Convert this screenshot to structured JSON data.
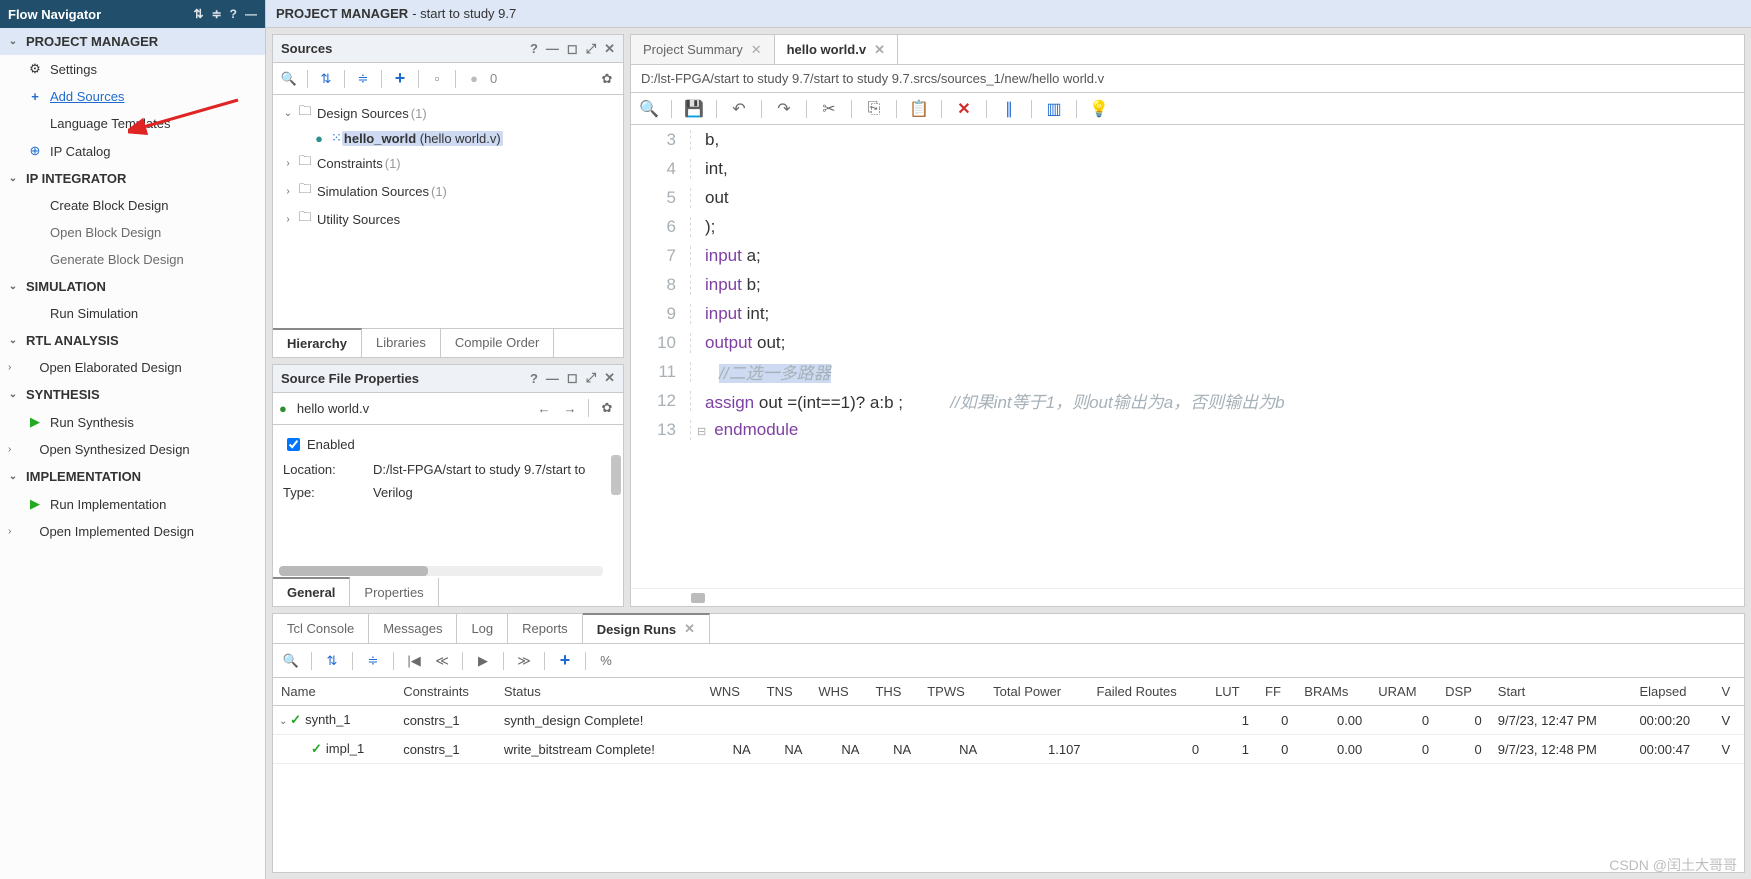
{
  "flowNavigator": {
    "title": "Flow Navigator",
    "sections": [
      {
        "label": "PROJECT MANAGER",
        "items": [
          {
            "label": "Settings",
            "icon": "gear"
          },
          {
            "label": "Add Sources",
            "link": true,
            "icon": "plus"
          },
          {
            "label": "Language Templates"
          },
          {
            "label": "IP Catalog",
            "icon": "ipcat"
          }
        ]
      },
      {
        "label": "IP INTEGRATOR",
        "items": [
          {
            "label": "Create Block Design"
          },
          {
            "label": "Open Block Design",
            "muted": true
          },
          {
            "label": "Generate Block Design",
            "muted": true
          }
        ]
      },
      {
        "label": "SIMULATION",
        "items": [
          {
            "label": "Run Simulation"
          }
        ]
      },
      {
        "label": "RTL ANALYSIS",
        "items": [
          {
            "label": "Open Elaborated Design",
            "chev": true
          }
        ]
      },
      {
        "label": "SYNTHESIS",
        "items": [
          {
            "label": "Run Synthesis",
            "icon": "play"
          },
          {
            "label": "Open Synthesized Design",
            "chev": true
          }
        ]
      },
      {
        "label": "IMPLEMENTATION",
        "items": [
          {
            "label": "Run Implementation",
            "icon": "play"
          },
          {
            "label": "Open Implemented Design",
            "chev": true
          }
        ]
      }
    ]
  },
  "projectManager": {
    "title": "PROJECT MANAGER",
    "subtitle": " - start to study 9.7"
  },
  "sources": {
    "title": "Sources",
    "count": "0",
    "tree": [
      {
        "label": "Design Sources",
        "count": "(1)",
        "expand": "down",
        "children": [
          {
            "label": "hello_world",
            "suffix": " (hello world.v)",
            "sel": true,
            "dot": true
          }
        ]
      },
      {
        "label": "Constraints",
        "count": "(1)",
        "expand": "right"
      },
      {
        "label": "Simulation Sources",
        "count": "(1)",
        "expand": "right"
      },
      {
        "label": "Utility Sources",
        "expand": "right"
      }
    ],
    "tabs": [
      "Hierarchy",
      "Libraries",
      "Compile Order"
    ]
  },
  "props": {
    "title": "Source File Properties",
    "file": "hello world.v",
    "enabled_label": "Enabled",
    "rows": [
      {
        "k": "Location:",
        "v": "D:/lst-FPGA/start to study 9.7/start to"
      },
      {
        "k": "Type:",
        "v": "Verilog"
      }
    ],
    "tabs": [
      "General",
      "Properties"
    ]
  },
  "editor": {
    "tabs": [
      {
        "label": "Project Summary",
        "active": false
      },
      {
        "label": "hello world.v",
        "active": true
      }
    ],
    "path": "D:/lst-FPGA/start to study 9.7/start to study 9.7.srcs/sources_1/new/hello world.v",
    "lines": [
      {
        "n": 3,
        "html": "b,"
      },
      {
        "n": 4,
        "html": "int,"
      },
      {
        "n": 5,
        "html": "out"
      },
      {
        "n": 6,
        "html": ");"
      },
      {
        "n": 7,
        "html": "<span class='kw'>input</span> a;"
      },
      {
        "n": 8,
        "html": "<span class='kw'>input</span> b;"
      },
      {
        "n": 9,
        "html": "<span class='kw'>input</span> int;"
      },
      {
        "n": 10,
        "html": "<span class='kw'>output</span> out;"
      },
      {
        "n": 11,
        "html": "   <span class='cmt hl'>//二选一多路器</span>"
      },
      {
        "n": 12,
        "html": "<span class='kw'>assign</span> out =(int==1)? a:b ;          <span class='cmt'>//如果int等于1，则out输出为a，否则输出为b</span>"
      },
      {
        "n": 13,
        "html": "<span class='kw'>endmodule</span>",
        "fold": true
      }
    ]
  },
  "bottom": {
    "tabs": [
      "Tcl Console",
      "Messages",
      "Log",
      "Reports",
      "Design Runs"
    ],
    "active": "Design Runs",
    "cols": [
      "Name",
      "Constraints",
      "Status",
      "WNS",
      "TNS",
      "WHS",
      "THS",
      "TPWS",
      "Total Power",
      "Failed Routes",
      "LUT",
      "FF",
      "BRAMs",
      "URAM",
      "DSP",
      "Start",
      "Elapsed",
      "V"
    ],
    "rows": [
      {
        "name": "synth_1",
        "indent": 0,
        "chev": true,
        "cons": "constrs_1",
        "status": "synth_design Complete!",
        "wns": "",
        "tns": "",
        "whs": "",
        "ths": "",
        "tpws": "",
        "tp": "",
        "fr": "",
        "lut": "1",
        "ff": "0",
        "brams": "0.00",
        "uram": "0",
        "dsp": "0",
        "start": "9/7/23, 12:47 PM",
        "el": "00:00:20",
        "v": "V"
      },
      {
        "name": "impl_1",
        "indent": 1,
        "chev": false,
        "cons": "constrs_1",
        "status": "write_bitstream Complete!",
        "wns": "NA",
        "tns": "NA",
        "whs": "NA",
        "ths": "NA",
        "tpws": "NA",
        "tp": "1.107",
        "fr": "0",
        "lut": "1",
        "ff": "0",
        "brams": "0.00",
        "uram": "0",
        "dsp": "0",
        "start": "9/7/23, 12:48 PM",
        "el": "00:00:47",
        "v": "V"
      }
    ]
  },
  "watermark": "CSDN @闰土大哥哥"
}
